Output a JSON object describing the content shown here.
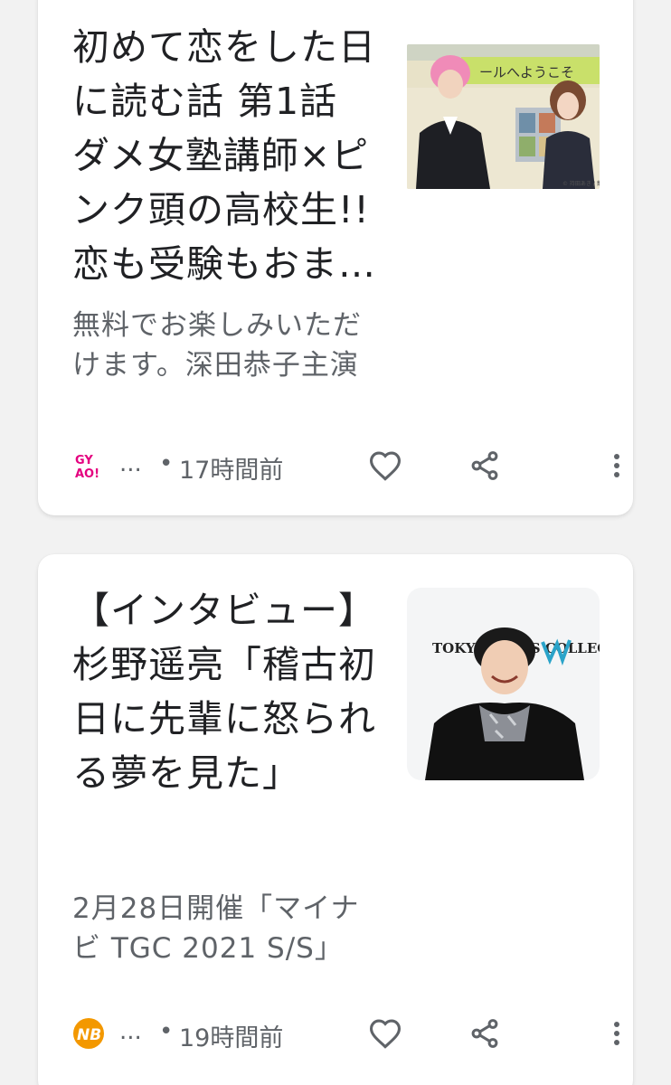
{
  "feed": {
    "cards": [
      {
        "title": "初めて恋をした日に読む話 第1話 ダメ女塾講師×ピンク頭の高校生!!恋も受験もおまかせを!",
        "snippet": "無料でお楽しみいただけます。深田恭子主演",
        "source_name": "...",
        "separator": "•",
        "time": "17時間前",
        "logo_text": "GY AO!",
        "thumb_sign": "ールへようこそ",
        "thumb_credit": "© 持田あき / 集英社",
        "icons": [
          "gyao-logo-icon",
          "heart-icon",
          "share-icon",
          "more-vert-icon"
        ]
      },
      {
        "title": "【インタビュー】杉野遥亮「稽古初日に先輩に怒られる夢を見た」",
        "snippet": "2月28日開催「マイナビ TGC 2021 S/S」",
        "source_name": "...",
        "separator": "•",
        "time": "19時間前",
        "logo_text": "NB",
        "thumb_backdrop": "TOKYO GIRLS COLLECTION マイナビ",
        "icons": [
          "nb-logo-icon",
          "heart-icon",
          "share-icon",
          "more-vert-icon"
        ]
      }
    ]
  },
  "colors": {
    "title": "#202124",
    "secondary": "#5f6368",
    "gyao_pink": "#e4007f",
    "nb_orange": "#f39800"
  }
}
